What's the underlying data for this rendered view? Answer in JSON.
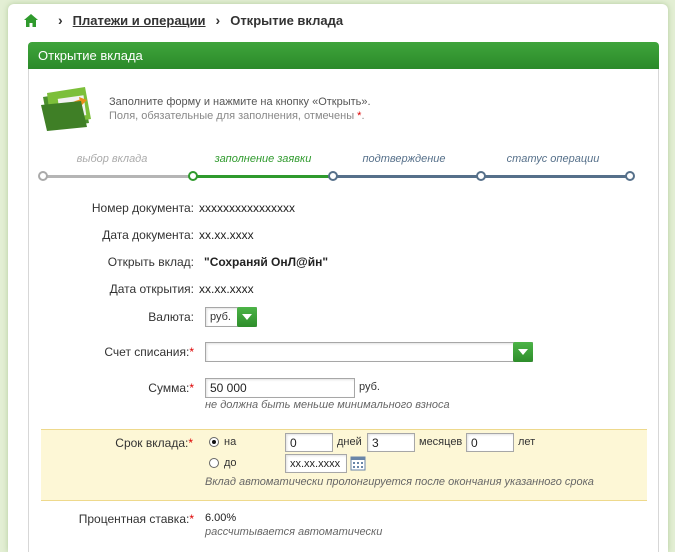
{
  "breadcrumb": {
    "link": "Платежи и операции",
    "current": "Открытие вклада"
  },
  "panel": {
    "title": "Открытие вклада"
  },
  "intro": {
    "line1": "Заполните форму и нажмите на кнопку «Открыть».",
    "line2": "Поля, обязательные для заполнения, отмечены ",
    "req_mark": "*",
    "line2_end": "."
  },
  "steps": [
    {
      "label": "выбор вклада",
      "state": "done"
    },
    {
      "label": "заполнение заявки",
      "state": "active"
    },
    {
      "label": "подтверждение",
      "state": "pending"
    },
    {
      "label": "статус операции",
      "state": "pending"
    }
  ],
  "colors": {
    "accent": "#2f9a2d",
    "required": "#dd0000",
    "step_pending": "#56708a",
    "highlight": "#fdf7d6"
  },
  "form": {
    "doc_number": {
      "label": "Номер документа:",
      "value": "xxxxxxxxxxxxxxxx"
    },
    "doc_date": {
      "label": "Дата документа:",
      "value": "xx.xx.xxxx"
    },
    "deposit": {
      "label": "Открыть вклад:",
      "value": "\"Сохраняй ОнЛ@йн\""
    },
    "open_date": {
      "label": "Дата открытия:",
      "value": "xx.xx.xxxx"
    },
    "currency": {
      "label": "Валюта:",
      "value": "руб."
    },
    "account": {
      "label": "Счет списания:",
      "req": "*",
      "value": ""
    },
    "amount": {
      "label": "Сумма:",
      "req": "*",
      "value": "50 000",
      "unit": "руб.",
      "note": "не должна быть меньше минимального взноса"
    },
    "term": {
      "label": "Срок вклада:",
      "req": "*",
      "option_on": "на",
      "option_until": "до",
      "days": "0",
      "days_label": "дней",
      "months": "3",
      "months_label": "месяцев",
      "years": "0",
      "years_label": "лет",
      "until_date": "xx.xx.xxxx",
      "note": "Вклад автоматически пролонгируется после окончания указанного срока"
    },
    "rate": {
      "label": "Процентная ставка:",
      "req": "*",
      "value": "6.00%",
      "note": "рассчитывается автоматически"
    }
  }
}
